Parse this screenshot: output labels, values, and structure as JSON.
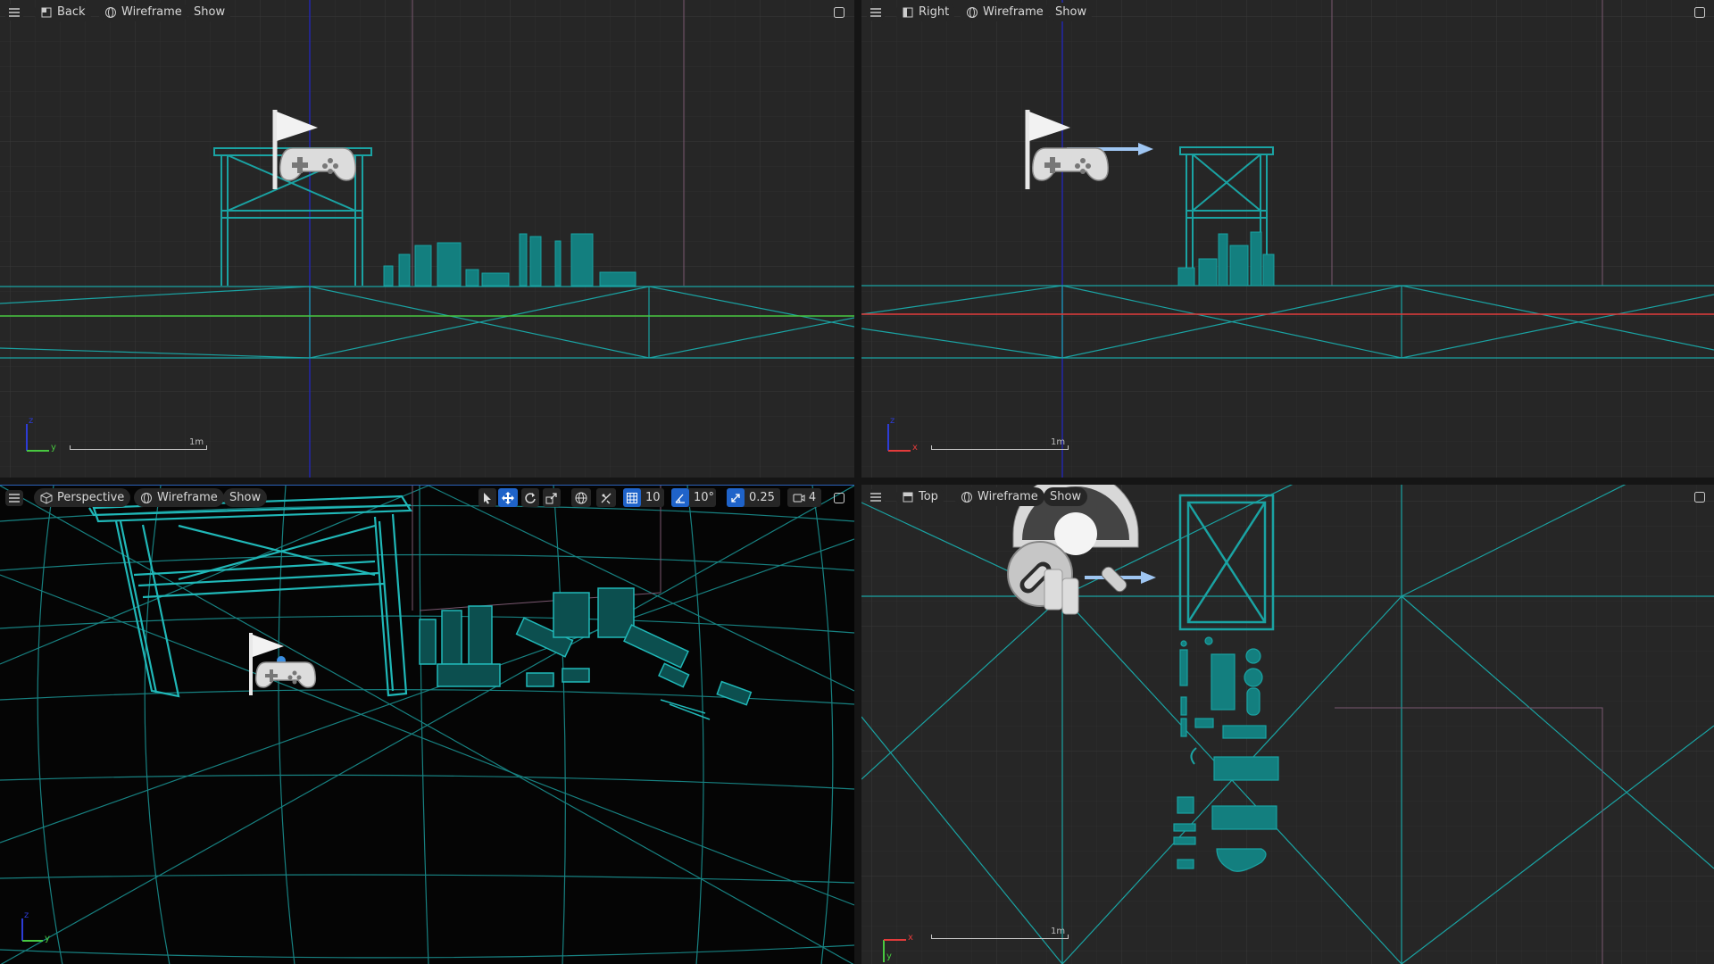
{
  "viewports": {
    "back": {
      "view_label": "Back",
      "mode_label": "Wireframe",
      "show_label": "Show",
      "axis_labels": [
        "z",
        "y"
      ],
      "scale_label": "1m"
    },
    "right": {
      "view_label": "Right",
      "mode_label": "Wireframe",
      "show_label": "Show",
      "axis_labels": [
        "z",
        "x"
      ],
      "scale_label": "1m"
    },
    "perspective": {
      "view_label": "Perspective",
      "mode_label": "Wireframe",
      "show_label": "Show",
      "axis_labels": [
        "z",
        "y"
      ],
      "toolbar": {
        "grid_snap_value": "10",
        "rotation_snap_value": "10°",
        "scale_snap_value": "0.25",
        "camera_speed_value": "4"
      }
    },
    "top": {
      "view_label": "Top",
      "mode_label": "Wireframe",
      "show_label": "Show",
      "axis_labels": [
        "x",
        "y"
      ],
      "scale_label": "1m"
    }
  },
  "colors": {
    "wire": "#1aa3a3",
    "grid": "#333333",
    "background_ortho": "#262626",
    "background_perspective": "#050505",
    "active_tool": "#1f63c9",
    "axis_x": "#e33b3b",
    "axis_y": "#48c840",
    "axis_z": "#2d3cd6"
  }
}
